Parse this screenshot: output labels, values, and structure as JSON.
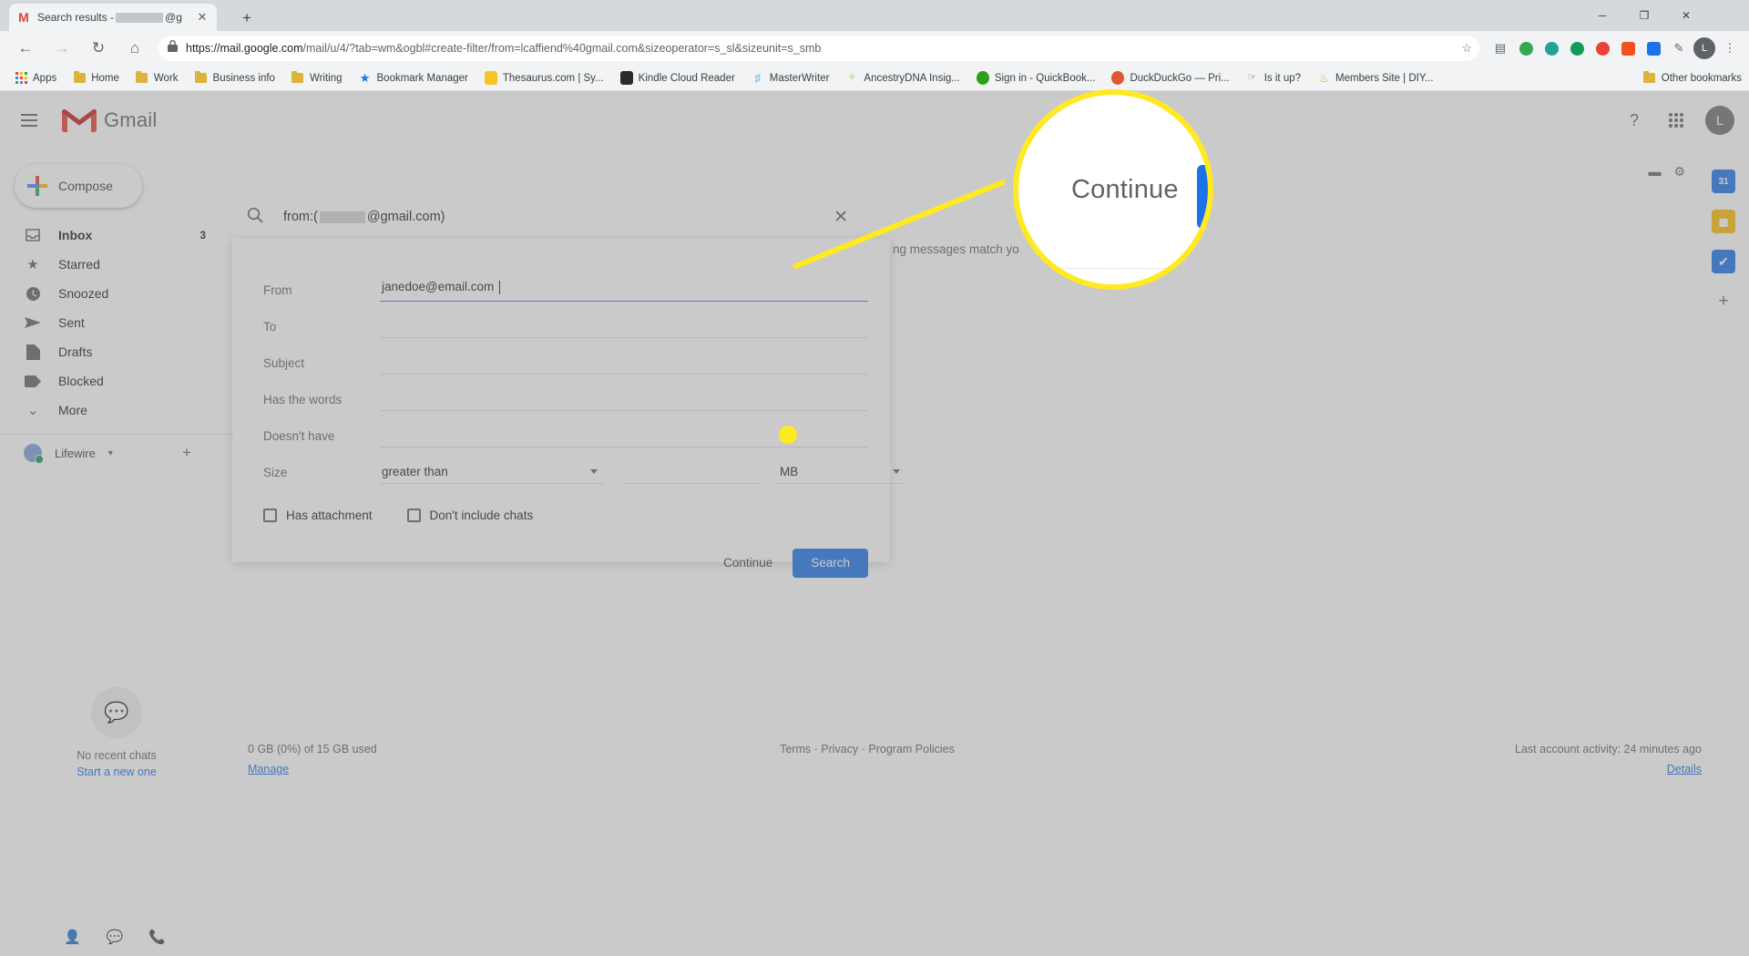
{
  "browser": {
    "tab": {
      "favicon": "gmail-m-icon",
      "title_prefix": "Search results - ",
      "title_suffix": "@g",
      "close": "✕"
    },
    "new_tab": "+",
    "window_controls": {
      "minimize": "─",
      "maximize": "❐",
      "close": "✕"
    },
    "nav": {
      "back": "←",
      "forward": "→",
      "reload": "↻",
      "home": "⌂"
    },
    "omnibox": {
      "lock": "lock-icon",
      "url_host": "https://mail.google.com",
      "url_path": "/mail/u/4/?tab=wm&ogbl#create-filter/from=lcaffiend%40gmail.com&sizeoperator=s_sl&sizeunit=s_smb",
      "star": "☆"
    },
    "extensions": [
      {
        "name": "card-extension-icon",
        "glyph": "▤",
        "color": "#5f6368"
      },
      {
        "name": "green-circle-extension-icon",
        "glyph": "",
        "color": "#34a853"
      },
      {
        "name": "teal-circle-extension-icon",
        "glyph": "",
        "color": "#1fa39b"
      },
      {
        "name": "green-dot-extension-icon",
        "glyph": "",
        "color": "#0f9d58"
      },
      {
        "name": "red-circle-extension-icon",
        "glyph": "",
        "color": "#ea4335"
      },
      {
        "name": "orange-square-extension-icon",
        "glyph": "",
        "color": "#f4511e"
      },
      {
        "name": "blue-square-extension-icon",
        "glyph": "",
        "color": "#1a73e8"
      },
      {
        "name": "pen-extension-icon",
        "glyph": "✎",
        "color": "#5f6368"
      }
    ],
    "profile_avatar": "L",
    "menu": "⋮",
    "bookmarks": [
      {
        "label": "Apps",
        "icon": "apps-grid-icon"
      },
      {
        "label": "Home",
        "icon": "folder-icon"
      },
      {
        "label": "Work",
        "icon": "folder-icon"
      },
      {
        "label": "Business info",
        "icon": "folder-icon"
      },
      {
        "label": "Writing",
        "icon": "folder-icon"
      },
      {
        "label": "Bookmark Manager",
        "icon": "star-icon"
      },
      {
        "label": "Thesaurus.com | Sy...",
        "icon": "thesaurus-icon"
      },
      {
        "label": "Kindle Cloud Reader",
        "icon": "kindle-icon"
      },
      {
        "label": "MasterWriter",
        "icon": "masterwriter-icon"
      },
      {
        "label": "AncestryDNA Insig...",
        "icon": "ancestry-icon"
      },
      {
        "label": "Sign in - QuickBook...",
        "icon": "quickbooks-icon"
      },
      {
        "label": "DuckDuckGo — Pri...",
        "icon": "duckduckgo-icon"
      },
      {
        "label": "Is it up?",
        "icon": "isitup-icon"
      },
      {
        "label": "Members Site | DIY...",
        "icon": "members-icon"
      }
    ],
    "other_bookmarks": "Other bookmarks"
  },
  "gmail": {
    "menu_icon": "hamburger-icon",
    "logo_text": "Gmail",
    "header_icons": {
      "help": "?",
      "apps": "apps-grid-icon",
      "avatar": "L"
    },
    "compose": "Compose",
    "nav_items": [
      {
        "label": "Inbox",
        "icon": "inbox-icon",
        "count": "3",
        "active": true
      },
      {
        "label": "Starred",
        "icon": "star-icon",
        "count": "",
        "active": false
      },
      {
        "label": "Snoozed",
        "icon": "clock-icon",
        "count": "",
        "active": false
      },
      {
        "label": "Sent",
        "icon": "send-icon",
        "count": "",
        "active": false
      },
      {
        "label": "Drafts",
        "icon": "file-icon",
        "count": "",
        "active": false
      },
      {
        "label": "Blocked",
        "icon": "label-icon",
        "count": "",
        "active": false
      },
      {
        "label": "More",
        "icon": "chevron-down-icon",
        "count": "",
        "active": false
      }
    ],
    "hangouts": {
      "account": "Lifewire",
      "add": "+",
      "empty_title": "No recent chats",
      "empty_link": "Start a new one",
      "footer_icons": [
        "contacts-icon",
        "chat-icon",
        "phone-icon"
      ]
    },
    "toolbar": {
      "density": "▬",
      "settings": "gear-icon"
    },
    "mail_note": "ng messages match yo",
    "footer": {
      "storage": "0 GB (0%) of 15 GB used",
      "manage": "Manage",
      "terms": "Terms",
      "privacy": "Privacy",
      "program_policies": "Program Policies",
      "separator": "·",
      "activity": "Last account activity: 24 minutes ago",
      "details": "Details"
    },
    "right_rail": [
      {
        "name": "calendar-icon",
        "glyph": "31",
        "color": "#1a73e8"
      },
      {
        "name": "keep-icon",
        "glyph": "■",
        "color": "#fbbc04"
      },
      {
        "name": "tasks-icon",
        "glyph": "✔",
        "color": "#1a73e8"
      },
      {
        "name": "add-icon",
        "glyph": "+",
        "color": "#5f6368"
      }
    ]
  },
  "search": {
    "icon": "search-icon",
    "query_prefix": "from:(",
    "query_suffix": "@gmail.com)",
    "close": "✕"
  },
  "filter": {
    "rows": [
      {
        "label": "From",
        "value": "janedoe@email.com",
        "placeholder": ""
      },
      {
        "label": "To",
        "value": "",
        "placeholder": ""
      },
      {
        "label": "Subject",
        "value": "",
        "placeholder": ""
      },
      {
        "label": "Has the words",
        "value": "",
        "placeholder": ""
      },
      {
        "label": "Doesn't have",
        "value": "",
        "placeholder": ""
      }
    ],
    "size": {
      "label": "Size",
      "operator": "greater than",
      "value": "",
      "unit": "MB"
    },
    "checkboxes": [
      {
        "label": "Has attachment",
        "checked": false
      },
      {
        "label": "Don't include chats",
        "checked": false
      }
    ],
    "continue_label": "Continue",
    "search_label": "Search"
  },
  "callout": {
    "magnified_label": "Continue",
    "highlight_color": "#ffe920",
    "button_color": "#1a73e8"
  }
}
